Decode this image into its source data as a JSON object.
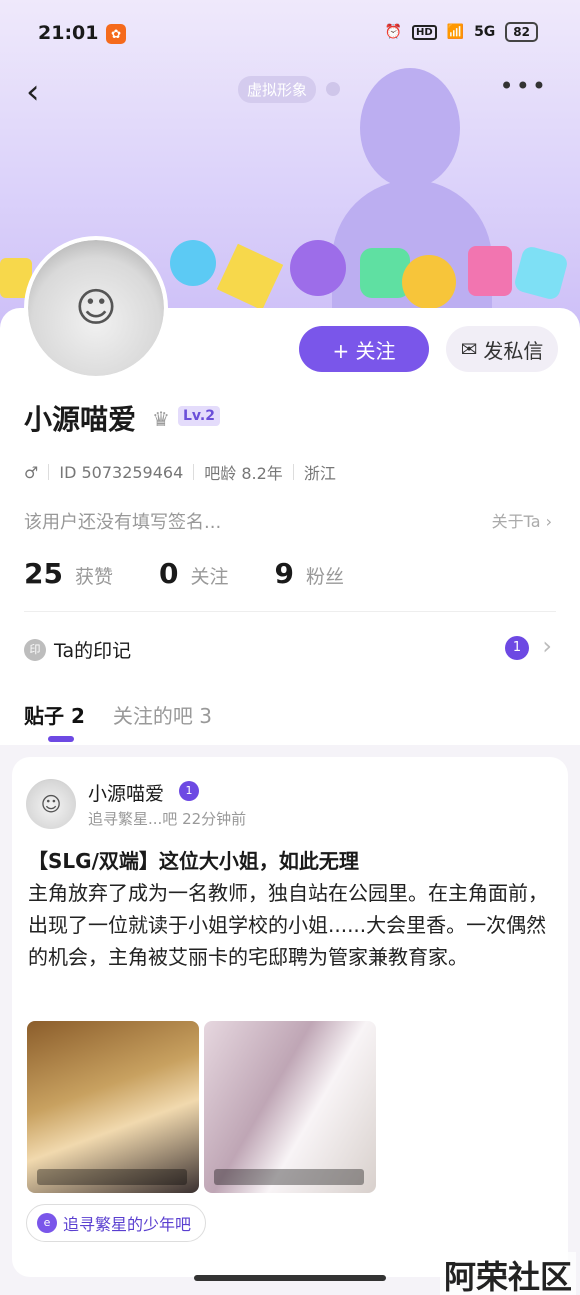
{
  "status_bar": {
    "time": "21:01",
    "net": "5G",
    "hd": "HD",
    "battery": "82"
  },
  "header": {
    "virtual_badge": "虚拟形象",
    "more": "•••",
    "back": "‹"
  },
  "profile": {
    "name": "小源喵爱",
    "level": "Lv.2",
    "gender_icon": "♂",
    "id": "ID 5073259464",
    "age": "吧龄 8.2年",
    "location": "浙江",
    "signature": "该用户还没有填写签名...",
    "about": "关于Ta ›"
  },
  "actions": {
    "follow": "+ 关注",
    "message": "发私信"
  },
  "stats": [
    {
      "num": "25",
      "label": "获赞"
    },
    {
      "num": "0",
      "label": "关注"
    },
    {
      "num": "9",
      "label": "粉丝"
    }
  ],
  "mark": {
    "label": "Ta的印记",
    "icon": "印",
    "badge": "1"
  },
  "tabs": [
    {
      "label": "贴子 2"
    },
    {
      "label": "关注的吧 3"
    }
  ],
  "post": {
    "author": "小源喵爱",
    "badge": "1",
    "meta": "追寻繁星...吧   22分钟前",
    "title": "【SLG/双端】这位大小姐，如此无理",
    "body": "主角放弃了成为一名教师，独自站在公园里。在主角面前，出现了一位就读于小姐学校的小姐......大会里香。一次偶然的机会，主角被艾丽卡的宅邸聘为管家兼教育家。",
    "forum": "追寻繁星的少年吧"
  },
  "watermark": "阿荣社区",
  "colors": {
    "accent": "#7a56ea",
    "header_top": "#efe9fb",
    "header_bottom": "#cdbff7"
  }
}
